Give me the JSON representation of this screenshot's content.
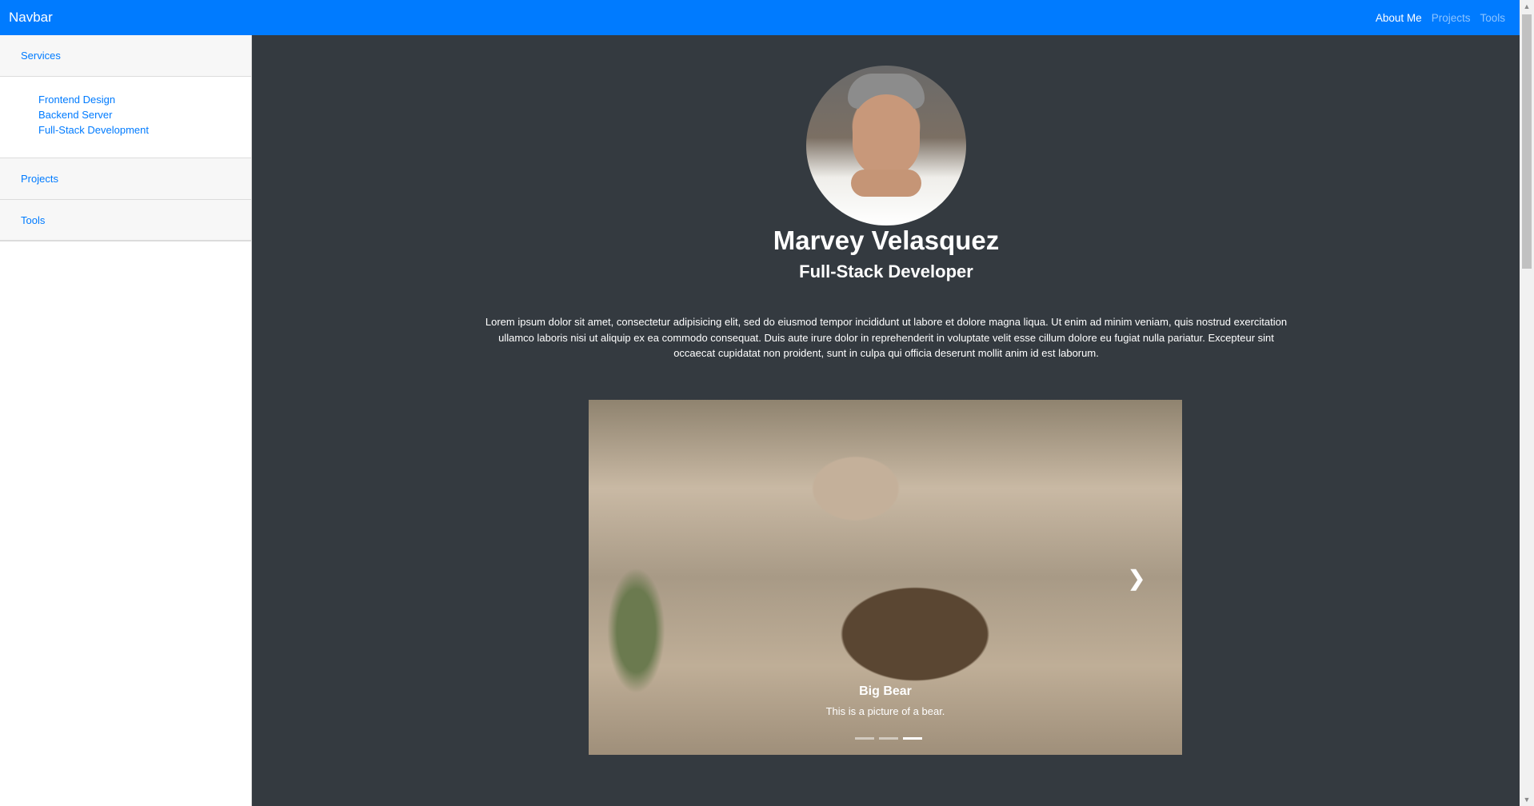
{
  "navbar": {
    "brand": "Navbar",
    "links": [
      {
        "label": "About Me"
      },
      {
        "label": "Projects"
      },
      {
        "label": "Tools"
      }
    ]
  },
  "sidebar": {
    "services": {
      "label": "Services",
      "items": [
        {
          "label": "Frontend Design"
        },
        {
          "label": "Backend Server"
        },
        {
          "label": "Full-Stack Development"
        }
      ]
    },
    "projects": {
      "label": "Projects"
    },
    "tools": {
      "label": "Tools"
    }
  },
  "profile": {
    "name": "Marvey Velasquez",
    "title": "Full-Stack Developer",
    "bio": "Lorem ipsum dolor sit amet, consectetur adipisicing elit, sed do eiusmod tempor incididunt ut labore et dolore magna liqua. Ut enim ad minim veniam, quis nostrud exercitation ullamco laboris nisi ut aliquip ex ea commodo consequat. Duis aute irure dolor in reprehenderit in voluptate velit esse cillum dolore eu fugiat nulla pariatur. Excepteur sint occaecat cupidatat non proident, sunt in culpa qui officia deserunt mollit anim id est laborum."
  },
  "carousel": {
    "caption_title": "Big Bear",
    "caption_text": "This is a picture of a bear.",
    "slide_count": 3,
    "active_index": 2,
    "next_icon": "chevron-right-icon"
  },
  "colors": {
    "primary": "#007bff",
    "main_background": "#343a40",
    "sidebar_background": "#ffffff"
  }
}
